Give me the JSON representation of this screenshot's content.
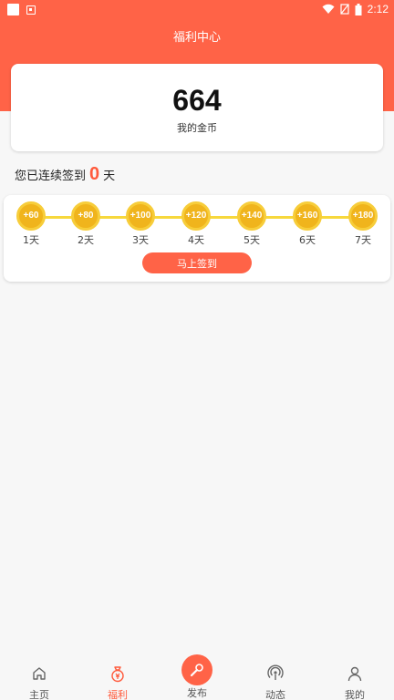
{
  "status_bar": {
    "time": "2:12"
  },
  "header": {
    "title": "福利中心"
  },
  "coins": {
    "value": "664",
    "label": "我的金币"
  },
  "streak": {
    "prefix": "您已连续签到",
    "days": "0",
    "suffix": "天"
  },
  "checkin": {
    "days": [
      {
        "reward": "+60",
        "label": "1天"
      },
      {
        "reward": "+80",
        "label": "2天"
      },
      {
        "reward": "+100",
        "label": "3天"
      },
      {
        "reward": "+120",
        "label": "4天"
      },
      {
        "reward": "+140",
        "label": "5天"
      },
      {
        "reward": "+160",
        "label": "6天"
      },
      {
        "reward": "+180",
        "label": "7天"
      }
    ],
    "button_label": "马上签到"
  },
  "nav": {
    "items": [
      {
        "label": "主页",
        "icon": "home-icon"
      },
      {
        "label": "福利",
        "icon": "money-bag-icon",
        "active": true
      },
      {
        "label": "发布",
        "icon": "microphone-icon"
      },
      {
        "label": "动态",
        "icon": "broadcast-icon"
      },
      {
        "label": "我的",
        "icon": "person-icon"
      }
    ]
  },
  "colors": {
    "accent": "#ff6347",
    "coin": "#f0b41c",
    "track": "#f7d83c"
  }
}
